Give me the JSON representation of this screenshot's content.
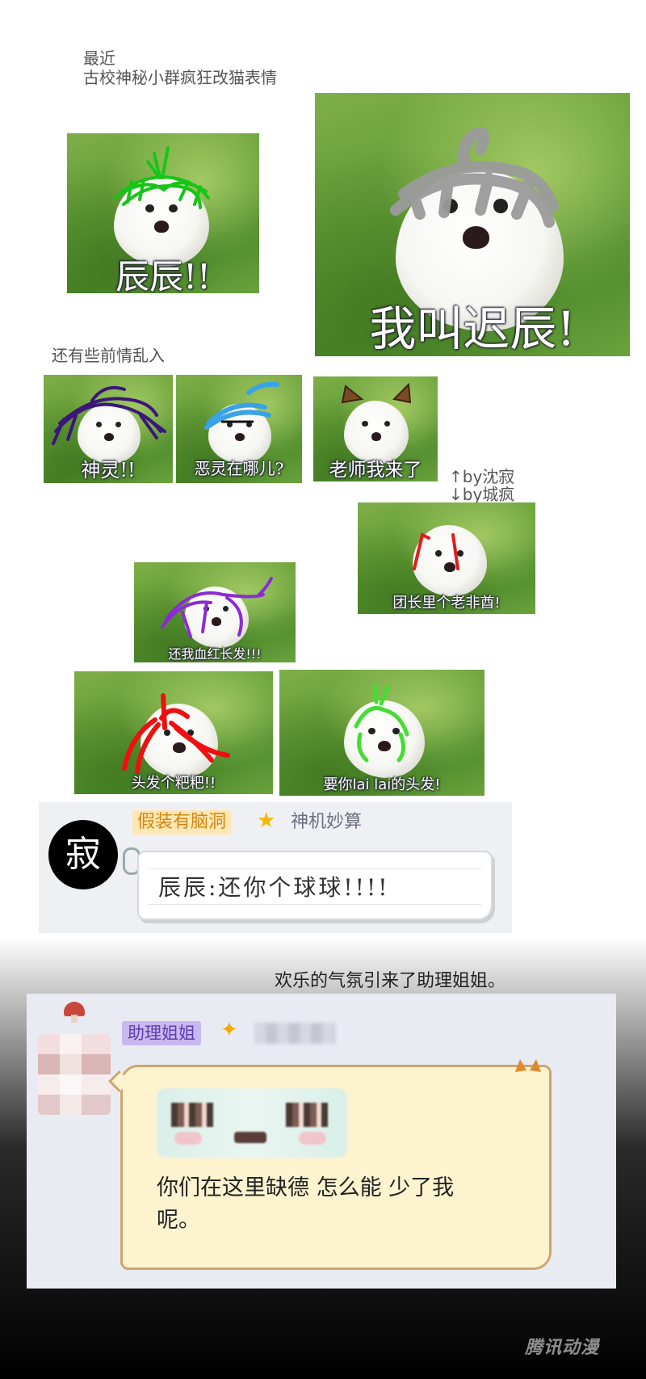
{
  "header": {
    "line1": "最近",
    "line2": "古校神秘小群疯狂改猫表情"
  },
  "memes": {
    "m1": "辰辰!!",
    "m2": "我叫迟辰!",
    "m3": "神灵!!",
    "m4": "恶灵在哪儿?",
    "m5": "老师我来了",
    "m6": "团长里个老非酋!",
    "m7": "还我血红长发!!!",
    "m8": "头发个粑粑!!",
    "m9": "要你lai lai的头发!"
  },
  "captions": {
    "prior": "还有些前情乱入",
    "by1": "↑by沈寂",
    "by2": "↓by城疯"
  },
  "chat1": {
    "avatar_char": "寂",
    "badge": "假装有脑洞",
    "title": "神机妙算",
    "message": "辰辰:还你个球球!!!!"
  },
  "assistant_caption": "欢乐的气氛引来了助理姐姐。",
  "chat2": {
    "badge": "助理姐姐",
    "message": "你们在这里缺德 怎么能 少了我呢。"
  },
  "watermark": "腾讯动漫",
  "colors": {
    "grass": "#5e9a32",
    "badge_yellow": "#fde7b3",
    "badge_purple": "#c9b7f0",
    "bubble_fill": "#fdf3cf"
  }
}
